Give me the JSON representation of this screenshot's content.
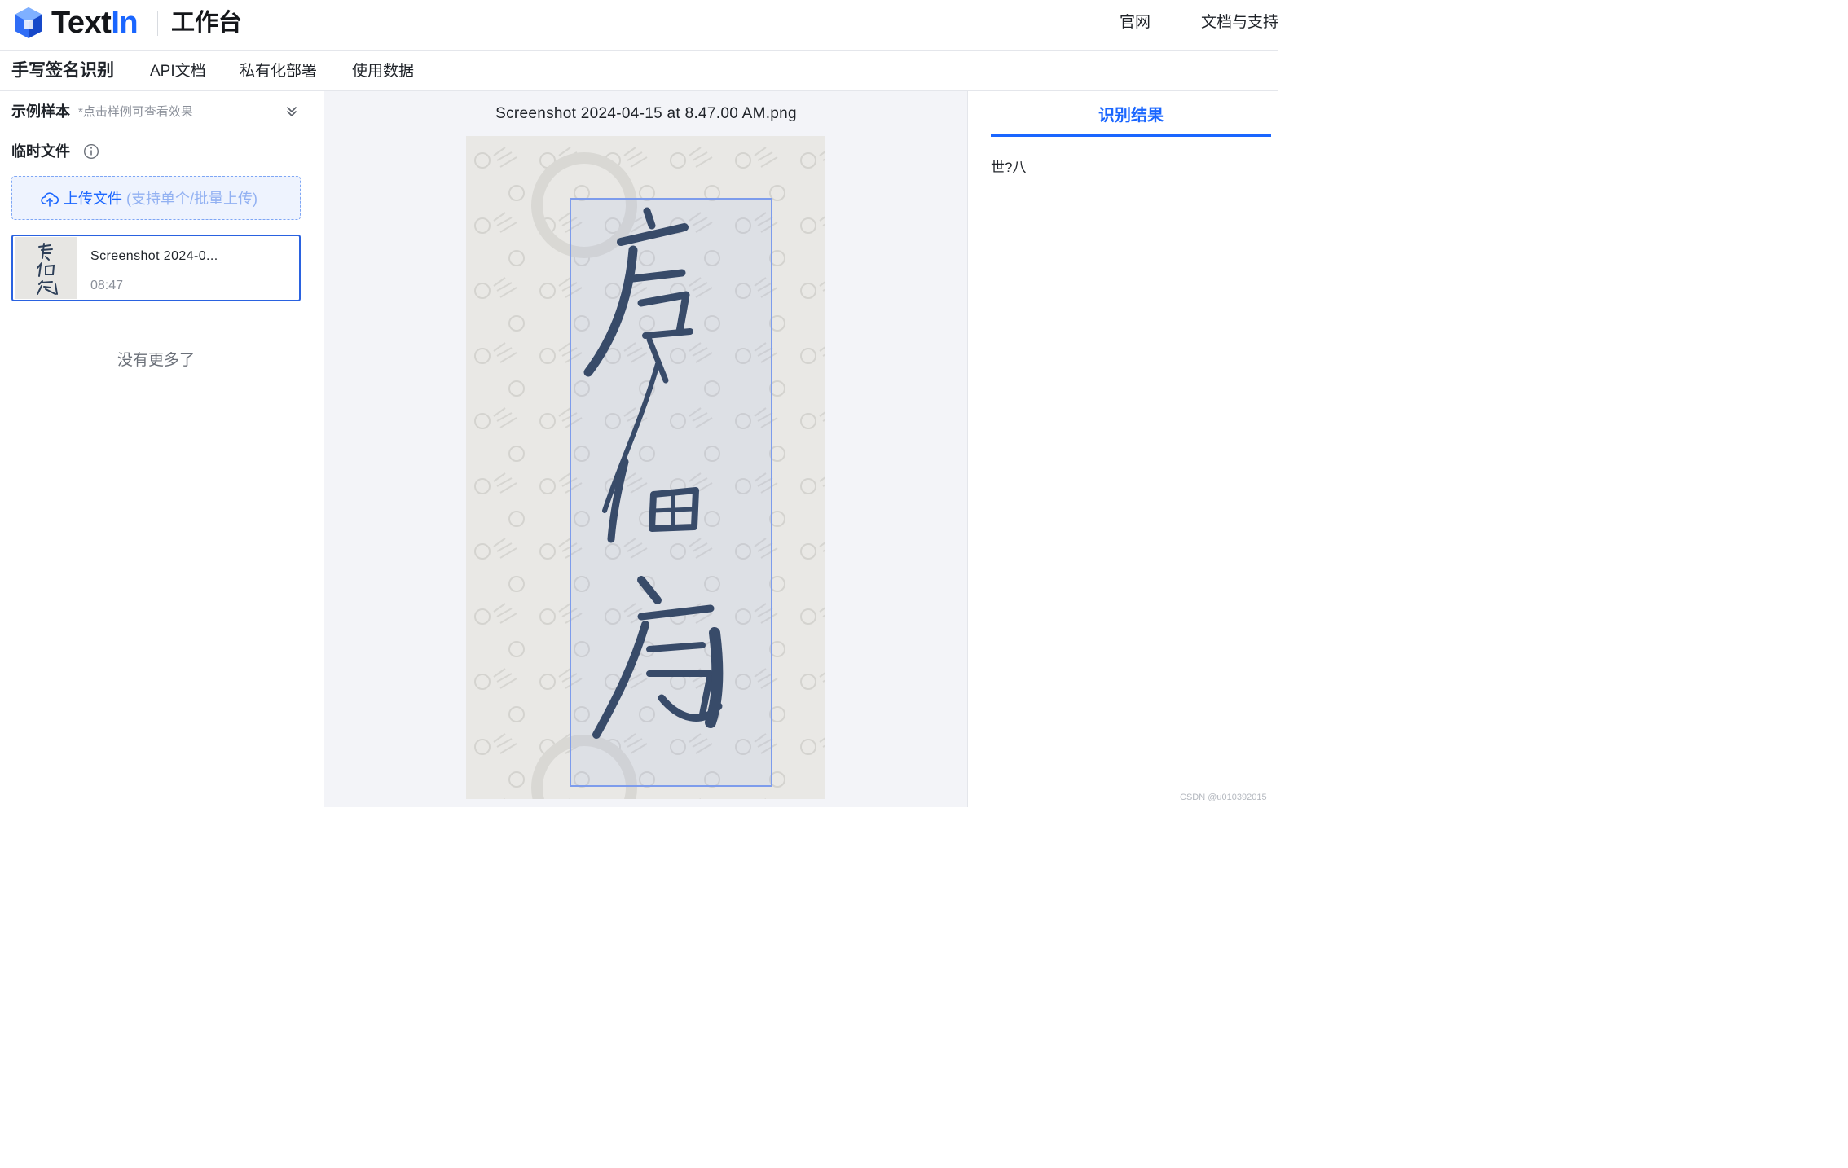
{
  "header": {
    "brand": {
      "prefix": "Text",
      "accent": "In"
    },
    "workbench": "工作台",
    "links": [
      "官网",
      "文档与支持"
    ],
    "accent_color": "#1a66ff"
  },
  "subnav": {
    "items": [
      "手写签名识别",
      "API文档",
      "私有化部署",
      "使用数据"
    ],
    "active": "手写签名识别"
  },
  "sidebar": {
    "samples_title": "示例样本",
    "samples_hint": "*点击样例可查看效果",
    "temp_title": "临时文件",
    "upload": {
      "label": "上传文件",
      "hint": "(支持单个/批量上传)"
    },
    "files": [
      {
        "name": "Screenshot 2024-0...",
        "time": "08:47",
        "selected": true
      }
    ],
    "no_more": "没有更多了"
  },
  "viewer": {
    "filename": "Screenshot 2024-04-15 at 8.47.00 AM.png"
  },
  "result_panel": {
    "tab": "识别结果",
    "text": "世?八"
  },
  "watermark": "CSDN @u010392015",
  "icons": [
    "textin-logo-icon",
    "chevron-double-down-icon",
    "info-icon",
    "upload-cloud-icon"
  ]
}
